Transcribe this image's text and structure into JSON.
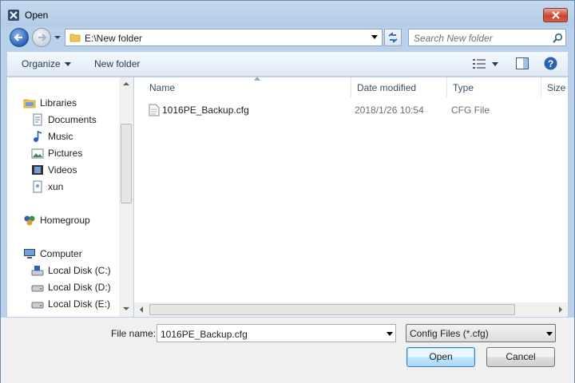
{
  "window": {
    "title": "Open"
  },
  "address": {
    "path": "E:\\New folder"
  },
  "search": {
    "placeholder": "Search New folder"
  },
  "toolbar": {
    "organize_label": "Organize",
    "new_folder_label": "New folder"
  },
  "nav": {
    "items": [
      {
        "label": "Libraries",
        "icon": "libraries-icon"
      },
      {
        "label": "Documents",
        "icon": "documents-icon"
      },
      {
        "label": "Music",
        "icon": "music-icon"
      },
      {
        "label": "Pictures",
        "icon": "pictures-icon"
      },
      {
        "label": "Videos",
        "icon": "videos-icon"
      },
      {
        "label": "xun",
        "icon": "user-folder-icon"
      },
      {
        "label": "Homegroup",
        "icon": "homegroup-icon"
      },
      {
        "label": "Computer",
        "icon": "computer-icon"
      },
      {
        "label": "Local Disk (C:)",
        "icon": "system-drive-icon"
      },
      {
        "label": "Local Disk (D:)",
        "icon": "drive-icon"
      },
      {
        "label": "Local Disk (E:)",
        "icon": "drive-icon"
      }
    ]
  },
  "columns": {
    "name": "Name",
    "date": "Date modified",
    "type": "Type",
    "size": "Size"
  },
  "files": [
    {
      "name": "1016PE_Backup.cfg",
      "date": "2018/1/26 10:54",
      "type": "CFG File"
    }
  ],
  "footer": {
    "file_name_label": "File name:",
    "file_name_value": "1016PE_Backup.cfg",
    "filter_value": "Config Files (*.cfg)",
    "open_label": "Open",
    "cancel_label": "Cancel"
  },
  "colors": {
    "chrome": "#b9d1ea",
    "toolbar": "#e0e9f4",
    "accent": "#3c7fb1",
    "close": "#c7442e"
  }
}
